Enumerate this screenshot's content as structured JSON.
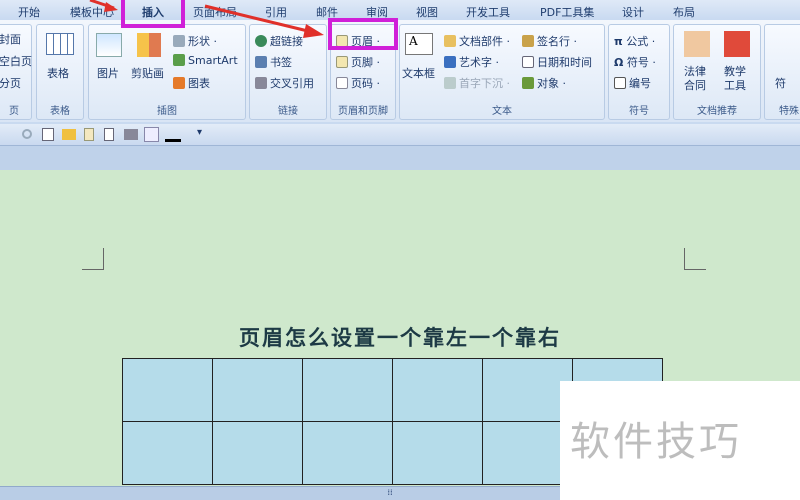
{
  "tabs": [
    "开始",
    "模板中心",
    "插入",
    "页面布局",
    "引用",
    "邮件",
    "审阅",
    "视图",
    "开发工具",
    "PDF工具集",
    "设计",
    "布局"
  ],
  "ribbon": {
    "left_partial": [
      "封面",
      "空白页",
      "分页",
      "页"
    ],
    "table": {
      "button": "表格",
      "label": "表格"
    },
    "illustrations": {
      "picture": "图片",
      "clipart": "剪贴画",
      "shapes": "形状",
      "smartart": "SmartArt",
      "chart": "图表",
      "label": "插图"
    },
    "links": {
      "hyperlink": "超链接",
      "bookmark": "书签",
      "crossref": "交叉引用",
      "label": "链接"
    },
    "header_footer": {
      "header": "页眉",
      "footer": "页脚",
      "page_number": "页码",
      "label": "页眉和页脚"
    },
    "text": {
      "textbox": "文本框",
      "quick_parts": "文档部件",
      "wordart": "艺术字",
      "dropcap": "首字下沉",
      "signature": "签名行",
      "datetime": "日期和时间",
      "object": "对象",
      "label": "文本"
    },
    "symbols": {
      "equation": "公式",
      "symbol": "符号",
      "numbering": "编号",
      "label": "符号"
    },
    "recommend": {
      "law": "法律合同",
      "teach": "教学工具",
      "label": "文档推荐"
    },
    "special": {
      "label": "特殊",
      "sym": "符"
    }
  },
  "document": {
    "title": "页眉怎么设置一个靠左一个靠右",
    "table_rows": 2,
    "table_cols": 6
  },
  "watermark": "软件技巧",
  "colors": {
    "highlight": "#d020d8",
    "arrow": "#e0302a",
    "page": "#cfe8cc",
    "cell": "#b5dcea"
  }
}
